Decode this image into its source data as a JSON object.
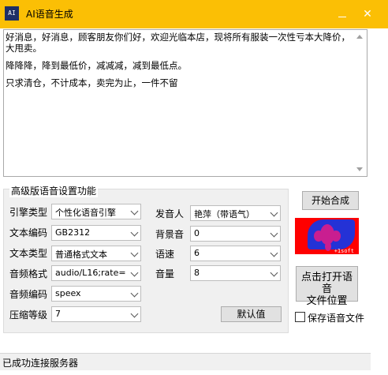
{
  "window": {
    "title": "AI语音生成",
    "icon_text": "AI",
    "min_symbol": "",
    "close_symbol": "✕"
  },
  "editor": {
    "lines": [
      "好消息，好消息，顾客朋友你们好，欢迎光临本店，现将所有服装一次性亏本大降价，大甩卖。",
      "降降降，降到最低价，减减减，减到最低点。",
      "只求清仓，不计成本，卖完为止，一件不留"
    ]
  },
  "settings": {
    "group_title": "高级版语音设置功能",
    "engine_label": "引擎类型",
    "engine_value": "个性化语音引擎",
    "speaker_label": "发音人",
    "speaker_value": "艳萍（带语气）",
    "encoding_label": "文本编码",
    "encoding_value": "GB2312",
    "bgm_label": "背景音",
    "bgm_value": "0",
    "texttype_label": "文本类型",
    "texttype_value": "普通格式文本",
    "speed_label": "语速",
    "speed_value": "6",
    "audioformat_label": "音频格式",
    "audioformat_value": "audio/L16;rate=",
    "volume_label": "音量",
    "volume_value": "8",
    "audiocode_label": "音频编码",
    "audiocode_value": "speex",
    "compress_label": "压缩等级",
    "compress_value": "7",
    "default_button": "默认值"
  },
  "actions": {
    "start_button": "开始合成",
    "open_button_line1": "点击打开语音",
    "open_button_line2": "文件位置",
    "save_checkbox_label": "保存语音文件",
    "save_checked": false
  },
  "logo": {
    "brand": "+1soft"
  },
  "status": {
    "text": "已成功连接服务器"
  },
  "colors": {
    "titlebar": "#fbbf05",
    "logo_red": "#fe0000",
    "logo_blue": "#2432d6"
  }
}
